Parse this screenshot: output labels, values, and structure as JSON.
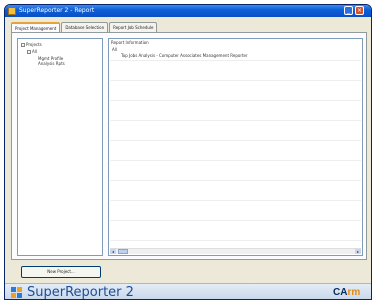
{
  "window": {
    "title": "SuperReporter 2 - Report"
  },
  "tabs": [
    {
      "label": "Project Management",
      "active": true
    },
    {
      "label": "Database Selection",
      "active": false
    },
    {
      "label": "Report Job Schedule",
      "active": false
    }
  ],
  "tree": {
    "root": "Projects",
    "child": "All",
    "leaves": [
      "Mgmt Profile",
      "Analysis Rpts"
    ]
  },
  "right_pane": {
    "label": "Report Information",
    "group": "All",
    "row_text": "Top Jobs Analysis - Computer Associates Management Reporter"
  },
  "bottom_button": {
    "label": "New Project..."
  },
  "brand": {
    "name": "SuperReporter 2",
    "logo_main": "CA",
    "logo_accent": "rm",
    "colors": {
      "blue": "#1f4e96",
      "orange": "#e08a10",
      "navy": "#0b2a5a"
    }
  },
  "icons": {
    "title": "app-window-icon",
    "minimize": "minimize-icon",
    "close": "close-icon",
    "brand": "superreporter-logo-icon"
  }
}
